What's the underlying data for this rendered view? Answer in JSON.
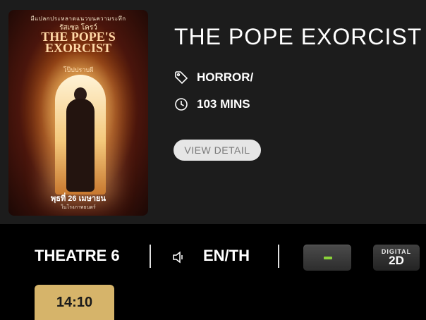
{
  "movie": {
    "title": "THE POPE EXORCIST",
    "genre": "HORROR/",
    "duration": "103 MINS",
    "view_detail_label": "VIEW DETAIL"
  },
  "poster": {
    "tagline": "มีแปลกประหลาดแนวบนความระทึก",
    "star": "รัสเซล โครว์",
    "logo_line1": "THE POPE'S",
    "logo_line2": "EXORCIST",
    "logo_thai": "โป๊ปปราบผี",
    "release_date": "พุธที่ 26 เมษายน",
    "release_sub": "ในโรงภาพยนตร์"
  },
  "showing": {
    "theatre": "THEATRE 6",
    "language": "EN/TH",
    "format_digital": "DIGITAL",
    "format_2d": "2D",
    "showtimes": [
      "14:10"
    ]
  },
  "icons": {
    "genre": "tag-icon",
    "duration": "clock-icon",
    "sound": "speaker-icon"
  },
  "colors": {
    "background": "#000000",
    "card": "#1c1c1c",
    "showtime": "#d6b46a",
    "format_accent": "#8bd33a",
    "button": "#e6e6e6"
  }
}
